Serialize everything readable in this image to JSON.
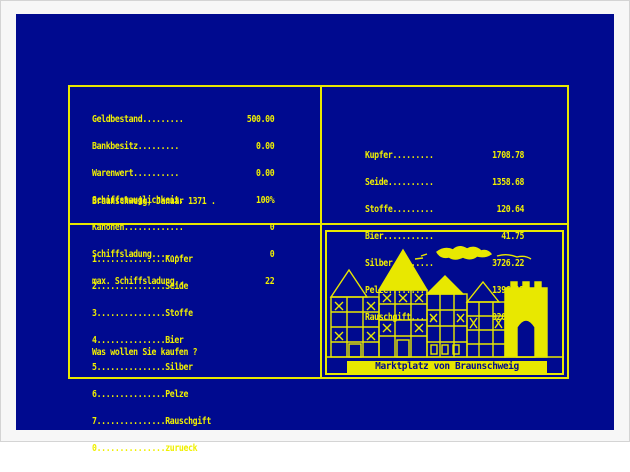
{
  "status": {
    "rows": [
      {
        "label": "Geldbestand.........",
        "value": "500.00"
      },
      {
        "label": "Bankbesitz.........",
        "value": "0.00"
      },
      {
        "label": "Warenwert..........",
        "value": "0.00"
      },
      {
        "label": "Schiffstauglichkeit.",
        "value": "100%"
      },
      {
        "label": "Kanonen.............",
        "value": "0"
      },
      {
        "label": "Schiffsladung.......",
        "value": "0"
      },
      {
        "label": "max. Schiffsladung..",
        "value": "22"
      }
    ],
    "location_date": "Braunschweig, Januar 1371 ."
  },
  "prices": [
    {
      "label": "Kupfer.........",
      "value": "1708.78"
    },
    {
      "label": "Seide..........",
      "value": "1358.68"
    },
    {
      "label": "Stoffe.........",
      "value": "120.64"
    },
    {
      "label": "Bier...........",
      "value": "41.75"
    },
    {
      "label": "Silber.........",
      "value": "3726.22"
    },
    {
      "label": "Pelze..........",
      "value": "1396.12"
    },
    {
      "label": "Rauschgift.....",
      "value": "9202.06"
    }
  ],
  "menu": {
    "items": [
      "1...............Kupfer",
      "2...............Seide",
      "3...............Stoffe",
      "4...............Bier",
      "5...............Silber",
      "6...............Pelze",
      "7...............Rauschgift",
      "0...............zurueck"
    ],
    "prompt": "Was wollen Sie kaufen ?"
  },
  "scene": {
    "caption": "Marktplatz von Braunschweig",
    "fg_color": "#e8e800",
    "bg_color": "#000a8f"
  }
}
